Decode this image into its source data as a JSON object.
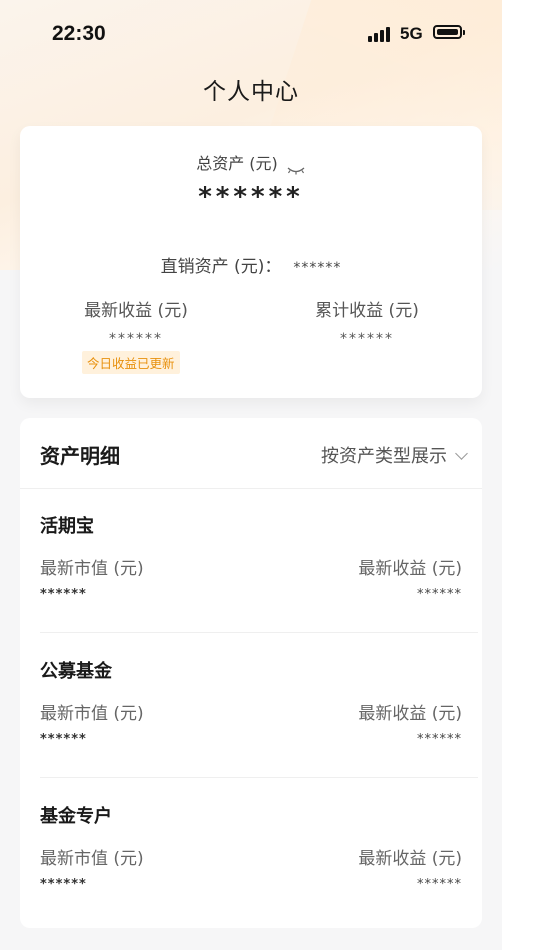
{
  "status_bar": {
    "time": "22:30",
    "network": "5G"
  },
  "page": {
    "title": "个人中心"
  },
  "summary": {
    "total_label": "总资产 (元)",
    "total_value": "******",
    "direct_label": "直销资产 (元)：",
    "direct_value": "******",
    "latest_income_label": "最新收益 (元)",
    "latest_income_value": "******",
    "cumulative_income_label": "累计收益 (元)",
    "cumulative_income_value": "******",
    "update_badge": "今日收益已更新"
  },
  "details": {
    "title": "资产明细",
    "filter_label": "按资产类型展示",
    "sections": [
      {
        "title": "活期宝",
        "left_label": "最新市值 (元)",
        "left_value": "******",
        "right_label": "最新收益 (元)",
        "right_value": "******"
      },
      {
        "title": "公募基金",
        "left_label": "最新市值 (元)",
        "left_value": "******",
        "right_label": "最新收益 (元)",
        "right_value": "******"
      },
      {
        "title": "基金专户",
        "left_label": "最新市值 (元)",
        "left_value": "******",
        "right_label": "最新收益 (元)",
        "right_value": "******"
      }
    ]
  },
  "colors": {
    "accent": "#e8910e",
    "badge_bg": "#fff1dc",
    "hero_bg": "#fcefe0"
  },
  "icons": {
    "hide_amount": "eye-closed-icon",
    "filter": "chevron-down-icon"
  }
}
